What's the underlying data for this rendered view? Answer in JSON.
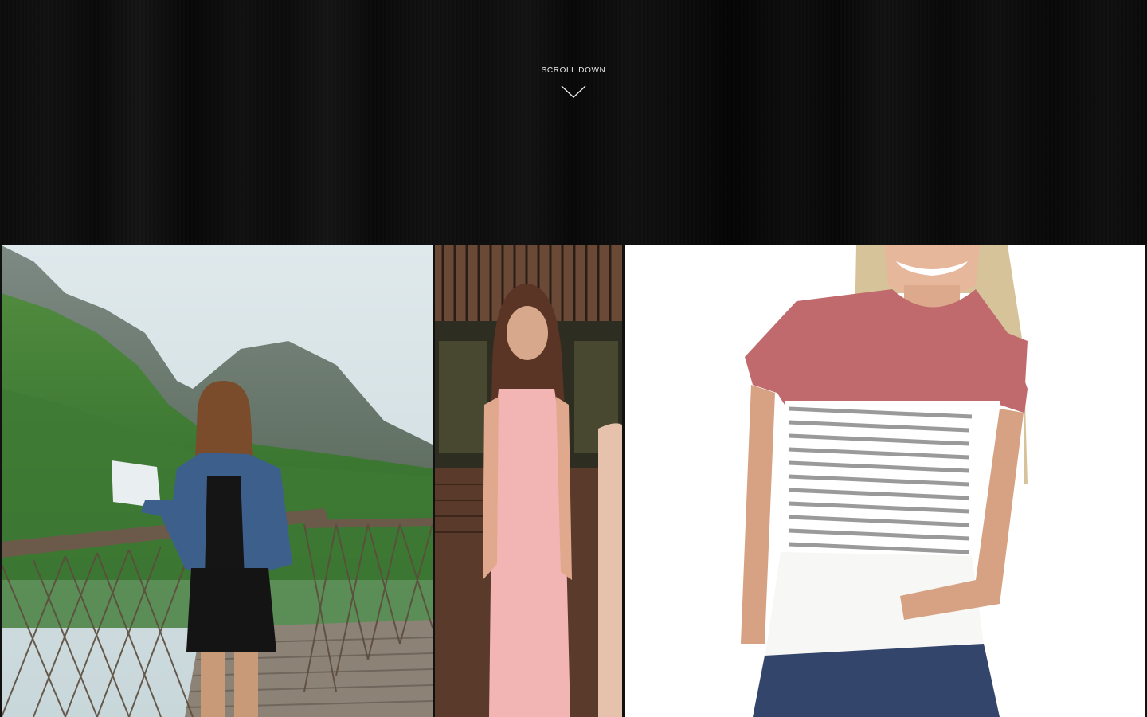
{
  "hero": {
    "scroll_label": "SCROLL DOWN",
    "arrow_icon": "chevron-down-icon"
  },
  "gallery": {
    "photos": [
      {
        "subject": "woman-on-canopy-walkway-photo"
      },
      {
        "subject": "woman-in-pink-dress-photo"
      },
      {
        "subject": "striped-tshirt-product-photo"
      }
    ]
  },
  "colors": {
    "hero_background": "#0b0b0b",
    "hero_text": "#e8e8e8",
    "gallery_gap": "#111111",
    "product_background": "#ffffff",
    "shirt_pink": "#c06a6e"
  }
}
